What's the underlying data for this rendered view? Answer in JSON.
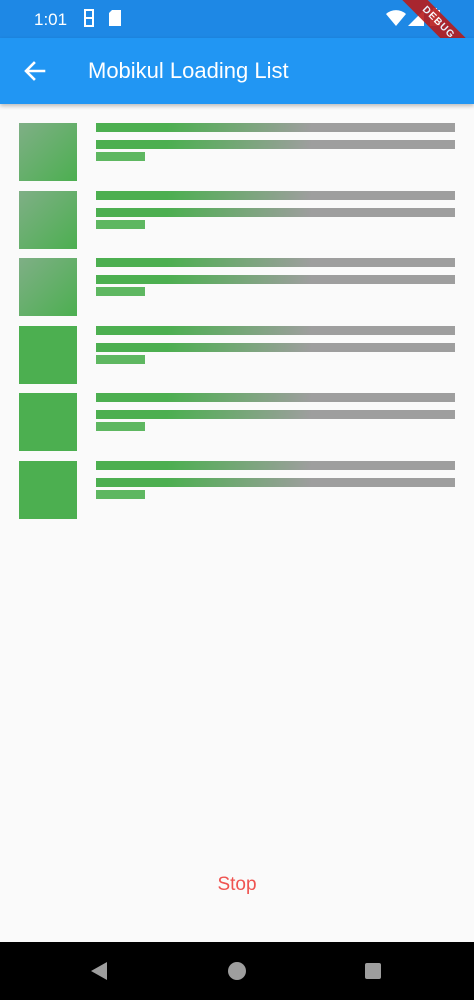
{
  "status_bar": {
    "time": "1:01",
    "icons": [
      "sim-icon",
      "sd-card-icon",
      "wifi-icon",
      "signal-icon",
      "battery-icon"
    ]
  },
  "debug_banner": {
    "label": "DEBUG"
  },
  "app_bar": {
    "title": "Mobikul Loading List",
    "back_icon": "arrow-back-icon"
  },
  "loading_list": {
    "item_count": 6,
    "colors": {
      "shimmer_base": "#9E9E9E",
      "shimmer_highlight": "#4CAF50"
    }
  },
  "actions": {
    "stop_label": "Stop"
  },
  "colors": {
    "status_bar": "#1E88E5",
    "app_bar": "#2196F3",
    "stop": "#EF5350",
    "background": "#FAFAFA"
  },
  "nav_bar": {
    "icons": [
      "back-triangle-icon",
      "home-circle-icon",
      "recents-square-icon"
    ]
  }
}
